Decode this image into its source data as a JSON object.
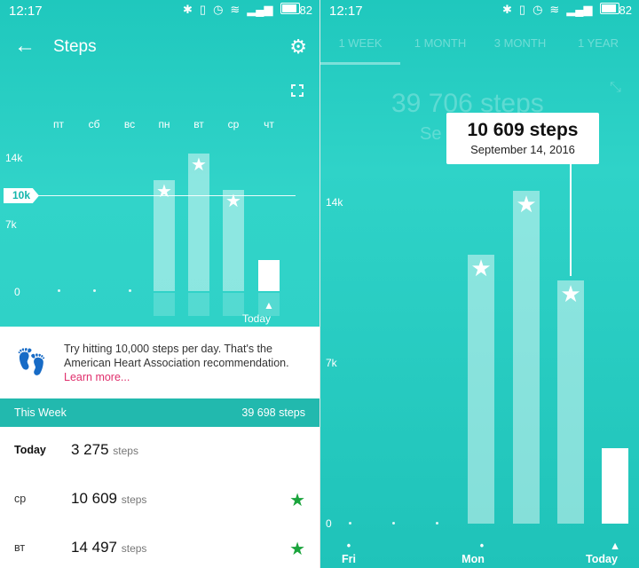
{
  "status": {
    "time": "12:17",
    "battery": "82"
  },
  "left": {
    "title": "Steps",
    "days": [
      "пт",
      "сб",
      "вс",
      "пн",
      "вт",
      "ср",
      "чт"
    ],
    "yticks": {
      "t14": "14k",
      "t7": "7k",
      "t0": "0"
    },
    "goal_label": "10k",
    "today_label": "Today",
    "tip": {
      "text": "Try hitting 10,000 steps per day. That's the American Heart Association recommendation.",
      "link": "Learn more..."
    },
    "week": {
      "label": "This Week",
      "total": "39 698 steps"
    },
    "rows": [
      {
        "day": "Today",
        "steps": "3 275",
        "unit": "steps",
        "star": false
      },
      {
        "day": "ср",
        "steps": "10 609",
        "unit": "steps",
        "star": true
      },
      {
        "day": "вт",
        "steps": "14 497",
        "unit": "steps",
        "star": true
      }
    ]
  },
  "right": {
    "tabs": [
      "1 WEEK",
      "1 MONTH",
      "3 MONTH",
      "1 YEAR"
    ],
    "ghost_total": "39 706 steps",
    "ghost_sub": "Se",
    "tooltip": {
      "value": "10 609 steps",
      "date": "September 14, 2016"
    },
    "yticks": {
      "t14": "14k",
      "t7": "7k",
      "t0": "0"
    },
    "xlabels": {
      "fri": "Fri",
      "mon": "Mon",
      "today": "Today"
    }
  },
  "chart_data": {
    "type": "bar",
    "categories": [
      "пт",
      "сб",
      "вс",
      "пн",
      "вт",
      "ср",
      "чт"
    ],
    "values": [
      0,
      0,
      0,
      11700,
      14497,
      10609,
      3275
    ],
    "ylim": [
      0,
      15000
    ],
    "goal": 10000
  },
  "colors": {
    "teal": "#2bcfc4",
    "accent_link": "#e0306d",
    "star_green": "#1aa43c"
  },
  "icons": {
    "back": "arrow-left-icon",
    "settings": "gear-icon",
    "expand": "expand-icon",
    "steps": "footprints-icon",
    "star": "star-icon"
  }
}
